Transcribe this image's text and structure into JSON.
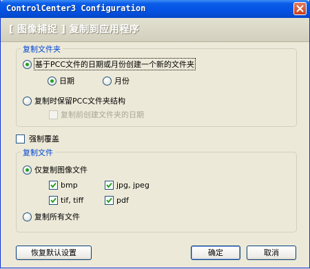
{
  "window": {
    "title": "ControlCenter3 Configuration"
  },
  "header": {
    "title": "[ 图像捕捉 ]  复制到应用程序"
  },
  "copy_folder": {
    "label": "复制文件夹",
    "option_date_folder": {
      "label": "基于PCC文件的日期或月份创建一个新的文件夹",
      "checked": true
    },
    "sub_date": {
      "label": "日期",
      "checked": true
    },
    "sub_month": {
      "label": "月份",
      "checked": false
    },
    "option_keep_structure": {
      "label": "复制时保留PCC文件夹结构",
      "checked": false
    },
    "create_date_folder": {
      "label": "复制前创建文件夹的日期",
      "checked": false,
      "disabled": true
    }
  },
  "force_overwrite": {
    "label": "强制覆盖",
    "checked": false
  },
  "copy_files": {
    "label": "复制文件",
    "option_images_only": {
      "label": "仅复制图像文件",
      "checked": true
    },
    "types": [
      {
        "label": "bmp",
        "checked": true
      },
      {
        "label": "jpg, jpeg",
        "checked": true
      },
      {
        "label": "tif, tiff",
        "checked": true
      },
      {
        "label": "pdf",
        "checked": true
      }
    ],
    "option_all_files": {
      "label": "复制所有文件",
      "checked": false
    }
  },
  "buttons": {
    "restore_defaults": "恢复默认设置",
    "ok": "确定",
    "cancel": "取消"
  },
  "colors": {
    "titlebar": "#0a5ce8",
    "group_label": "#0046d5",
    "check": "#22a022"
  }
}
